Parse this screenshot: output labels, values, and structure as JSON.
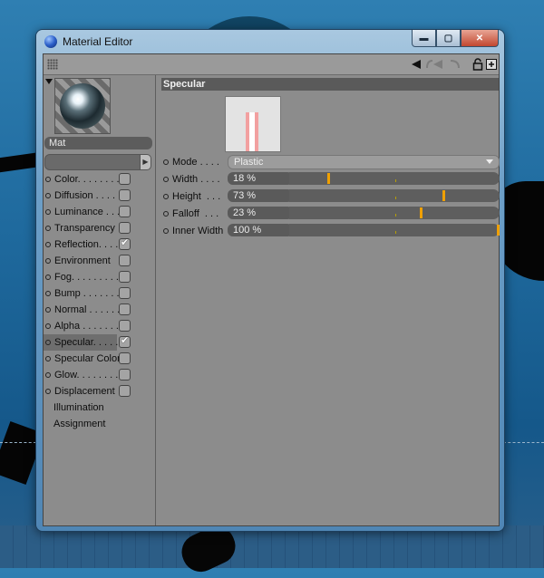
{
  "window": {
    "title": "Material Editor"
  },
  "window_buttons": {
    "minimize": "▬",
    "maximize": "▢",
    "close": "✕"
  },
  "colors": {
    "panel": "#8c8c8c",
    "field": "#5a5a5a",
    "accent": "#f0a000",
    "section": "#5a5a5a"
  },
  "material": {
    "name": "Mat"
  },
  "channels": [
    {
      "label": "Color. . . . . . . .",
      "checked": false,
      "active": false
    },
    {
      "label": "Diffusion . . . . .",
      "checked": false,
      "active": false
    },
    {
      "label": "Luminance . . . .",
      "checked": false,
      "active": false
    },
    {
      "label": "Transparency",
      "checked": false,
      "active": false
    },
    {
      "label": "Reflection. . . .",
      "checked": true,
      "active": false
    },
    {
      "label": "Environment",
      "checked": false,
      "active": false
    },
    {
      "label": "Fog. . . . . . . . .",
      "checked": false,
      "active": false
    },
    {
      "label": "Bump . . . . . . .",
      "checked": false,
      "active": false
    },
    {
      "label": "Normal . . . . . .",
      "checked": false,
      "active": false
    },
    {
      "label": "Alpha . . . . . . .",
      "checked": false,
      "active": false
    },
    {
      "label": "Specular. . . . .",
      "checked": true,
      "active": true
    },
    {
      "label": "Specular Color",
      "checked": false,
      "active": false
    },
    {
      "label": "Glow. . . . . . . .",
      "checked": false,
      "active": false
    },
    {
      "label": "Displacement",
      "checked": false,
      "active": false
    }
  ],
  "extra_items": [
    "Illumination",
    "Assignment"
  ],
  "specular": {
    "section_title": "Specular",
    "mode": {
      "label": "Mode . . . .",
      "value": "Plastic"
    },
    "params": [
      {
        "label": "Width . . . .",
        "value": "18 %",
        "fraction": 0.18
      },
      {
        "label": "Height  . . .",
        "value": "73 %",
        "fraction": 0.73
      },
      {
        "label": "Falloff  . . .",
        "value": "23 %",
        "fraction": 0.62
      },
      {
        "label": "Inner Width",
        "value": "100 %",
        "fraction": 1.0
      }
    ]
  }
}
